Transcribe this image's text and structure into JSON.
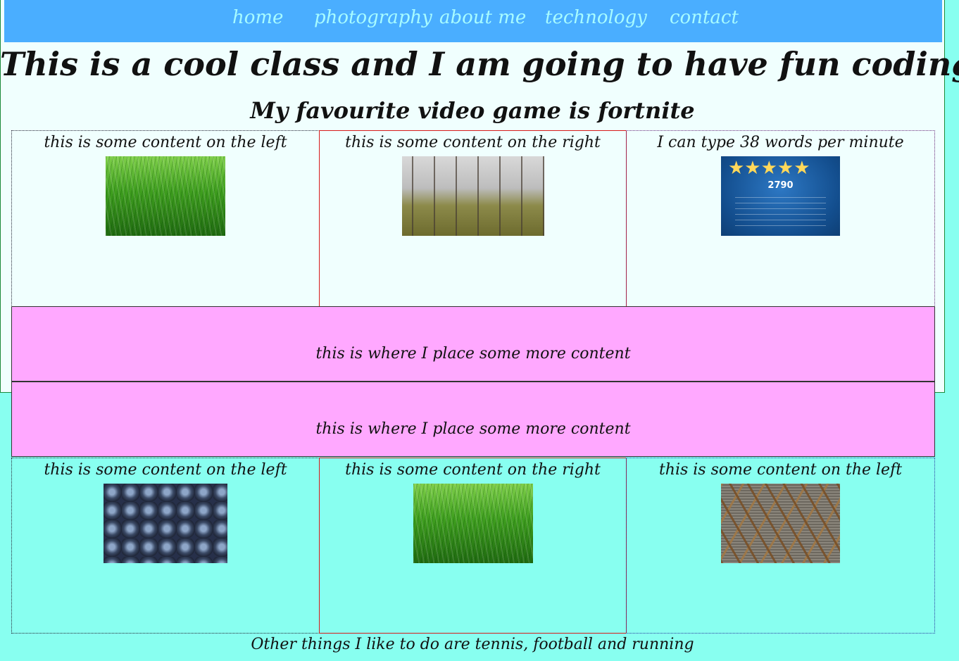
{
  "nav": {
    "items": [
      {
        "label": "home"
      },
      {
        "label": "photography"
      },
      {
        "label": "about me"
      },
      {
        "label": "technology"
      },
      {
        "label": "contact"
      }
    ]
  },
  "header": {
    "title": "This is a cool class and I am going to have fun coding",
    "subtitle": "My favourite video game is fortnite"
  },
  "row1": {
    "left_caption": "this is some content on the left",
    "middle_caption": "this is some content on the right",
    "right_caption": "I can type 38 words per minute",
    "typing_score": "2790",
    "typing_stars": "★★★★★"
  },
  "bands": [
    {
      "text": "this is where I place some more content"
    },
    {
      "text": "this is where I place some more content"
    }
  ],
  "row2": {
    "left_caption": "this is some content on the left",
    "middle_caption": "this is some content on the right",
    "right_caption": "this is some content on the left"
  },
  "footer": {
    "text": "Other things I like to do are tennis, football and running"
  },
  "colors": {
    "nav_bg": "#4aaeff",
    "nav_text": "#a7fbff",
    "panel_bg": "#f0fffe",
    "page_bg": "#88fff0",
    "band_bg": "#ffa8ff"
  }
}
